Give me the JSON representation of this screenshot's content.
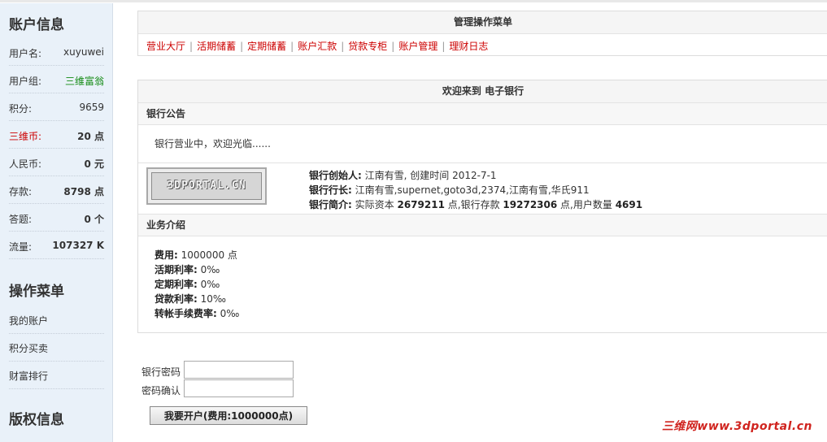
{
  "sidebar": {
    "account_title": "账户信息",
    "info": [
      {
        "label": "用户名:",
        "value": "xuyuwei"
      },
      {
        "label": "用户组:",
        "value": "三维富翁"
      },
      {
        "label": "积分:",
        "value": "9659"
      },
      {
        "label": "三维币:",
        "value": "20 点"
      },
      {
        "label": "人民币:",
        "value": "0 元"
      },
      {
        "label": "存款:",
        "value": "8798 点"
      },
      {
        "label": "答题:",
        "value": "0 个"
      },
      {
        "label": "流量:",
        "value": "107327 K"
      }
    ],
    "menu_title": "操作菜单",
    "menu": [
      "我的账户",
      "积分买卖",
      "财富排行"
    ],
    "copyright_title": "版权信息"
  },
  "manage_menu": {
    "title": "管理操作菜单",
    "links": [
      "营业大厅",
      "活期储蓄",
      "定期储蓄",
      "账户汇款",
      "贷款专柜",
      "账户管理",
      "理财日志"
    ],
    "separator": "|"
  },
  "welcome": {
    "title": "欢迎来到 电子银行",
    "notice_head": "银行公告",
    "notice_text": "银行营业中，欢迎光临......",
    "logo_text": "3DPORTAL.CN",
    "founder_label": "银行创始人:",
    "founder_value": "江南有雪, 创建时间 2012-7-1",
    "president_label": "银行行长:",
    "president_value": "江南有雪,supernet,goto3d,2374,江南有雪,华氏911",
    "summary_label": "银行简介:",
    "summary_t1": "实际资本",
    "summary_capital": "2679211",
    "summary_t2": "点,银行存款",
    "summary_deposit": "19272306",
    "summary_t3": "点,用户数量",
    "summary_users": "4691",
    "business_head": "业务介绍",
    "fees": [
      {
        "label": "费用:",
        "value": "1000000 点"
      },
      {
        "label": "活期利率:",
        "value": "0‰"
      },
      {
        "label": "定期利率:",
        "value": "0‰"
      },
      {
        "label": "贷款利率:",
        "value": "10‰"
      },
      {
        "label": "转帐手续费率:",
        "value": "0‰"
      }
    ]
  },
  "form": {
    "password_label": "银行密码",
    "password_value": "",
    "confirm_label": "密码确认",
    "confirm_value": "",
    "submit_label": "我要开户(费用:1000000点)"
  },
  "watermark": "三维网www.3dportal.cn"
}
